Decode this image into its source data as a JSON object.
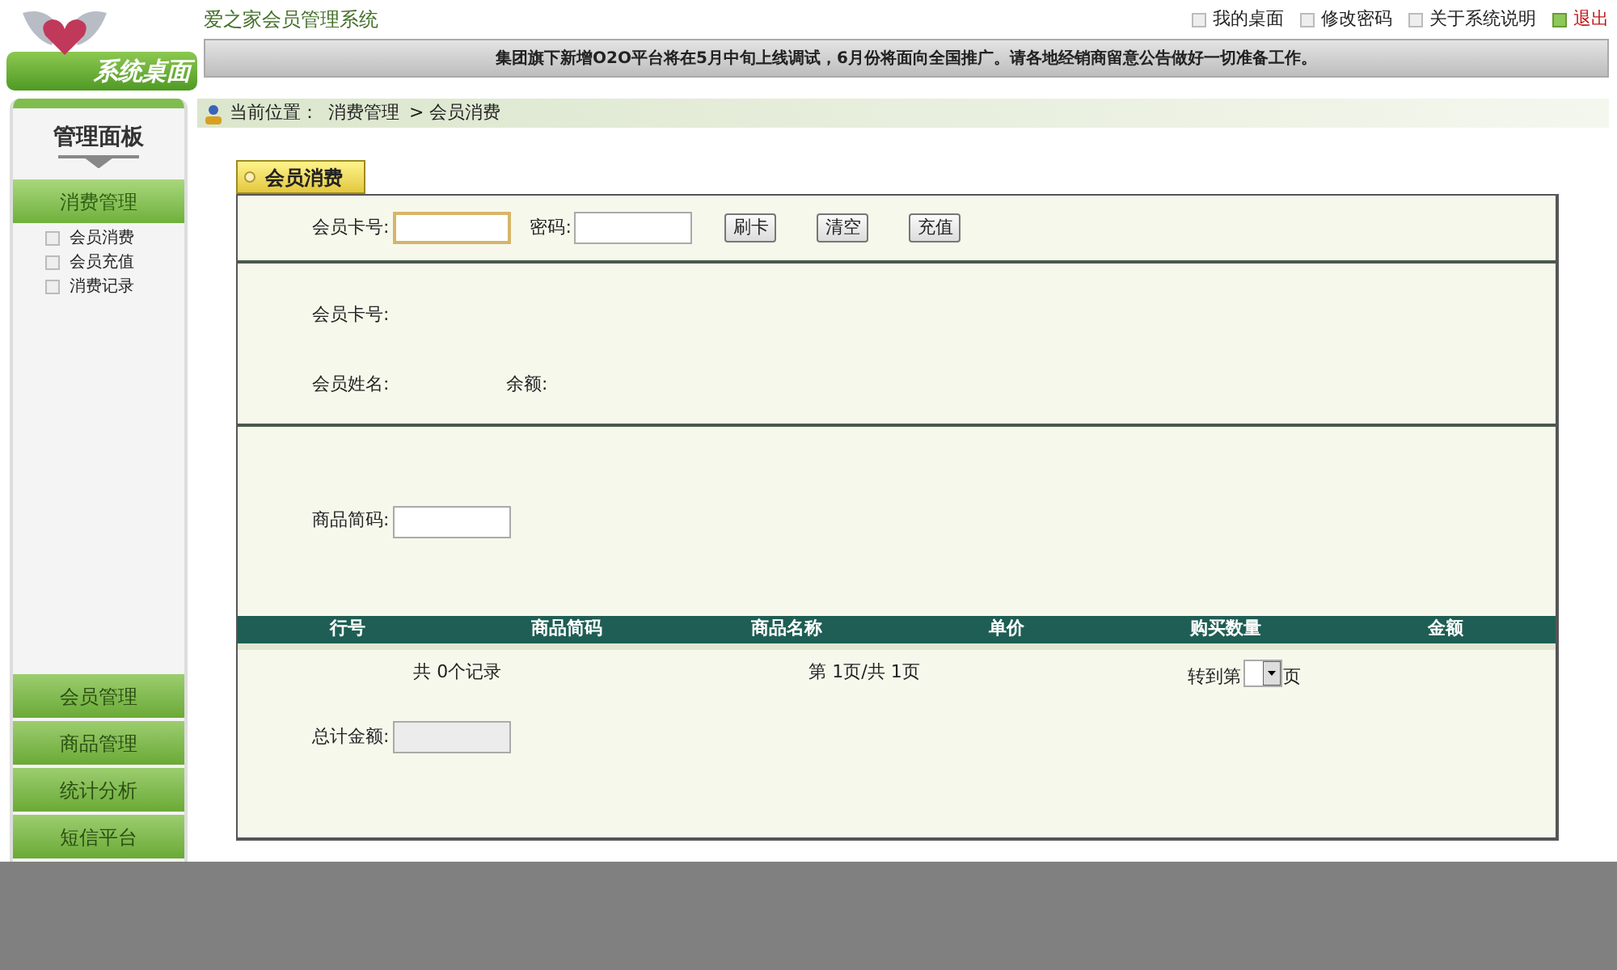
{
  "logo": {
    "text": "系统桌面"
  },
  "app_title": "爱之家会员管理系统",
  "top_links": [
    {
      "label": "我的桌面",
      "kind": "normal"
    },
    {
      "label": "修改密码",
      "kind": "normal"
    },
    {
      "label": "关于系统说明",
      "kind": "normal"
    },
    {
      "label": "退出",
      "kind": "logout"
    }
  ],
  "notice": "集团旗下新增O2O平台将在5月中旬上线调试，6月份将面向全国推广。请各地经销商留意公告做好一切准备工作。",
  "sidebar": {
    "title": "管理面板",
    "sections": [
      {
        "label": "消费管理",
        "expanded": true,
        "items": [
          "会员消费",
          "会员充值",
          "消费记录"
        ]
      },
      {
        "label": "会员管理",
        "expanded": false
      },
      {
        "label": "商品管理",
        "expanded": false
      },
      {
        "label": "统计分析",
        "expanded": false
      },
      {
        "label": "短信平台",
        "expanded": false
      }
    ]
  },
  "breadcrumb": {
    "label": "当前位置：",
    "path": [
      "消费管理",
      "> 会员消费"
    ]
  },
  "tab": "会员消费",
  "card_form": {
    "card_label": "会员卡号:",
    "password_label": "密码:",
    "buttons": [
      "刷卡",
      "清空",
      "充值"
    ]
  },
  "member_info": {
    "card_label": "会员卡号:",
    "name_label": "会员姓名:",
    "balance_label": "余额:"
  },
  "product": {
    "code_label": "商品简码:"
  },
  "table": {
    "columns": [
      "行号",
      "商品简码",
      "商品名称",
      "单价",
      "购买数量",
      "金额"
    ]
  },
  "pager": {
    "records": "共 0个记录",
    "pages": "第 1页/共 1页",
    "goto_label": "转到第",
    "goto_suffix": "页"
  },
  "total": {
    "label": "总计金额:"
  }
}
